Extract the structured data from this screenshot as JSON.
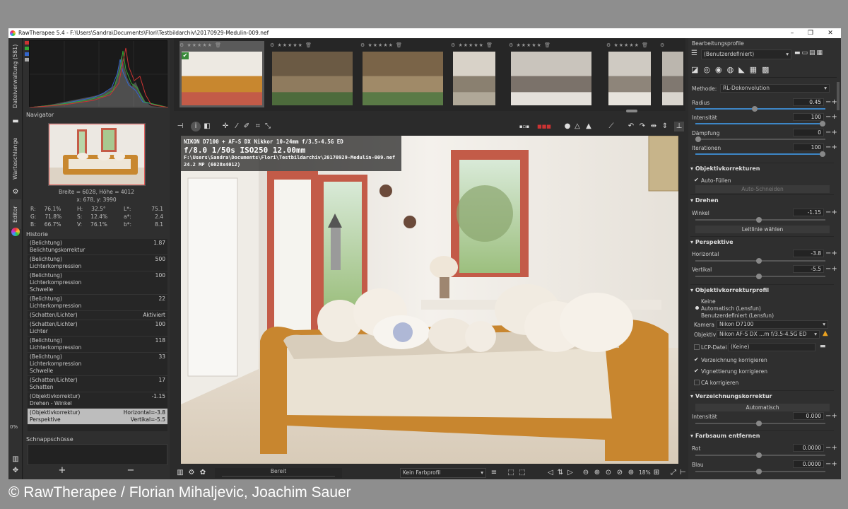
{
  "window": {
    "title": "RawTherapee 5.4 - F:\\Users\\Sandra\\Documents\\Flori\\Testbildarchiv\\20170929-Medulin-009.nef",
    "minimize": "–",
    "maximize": "❐",
    "close": "✕"
  },
  "sidetabs": {
    "file_browser": "Dateiverwaltung (581)",
    "queue": "Warteschlange",
    "editor": "Editor"
  },
  "navigator": {
    "title": "Navigator",
    "size": "Breite = 6028, Höhe = 4012",
    "coords": "x: 678, y: 3990",
    "rgb": [
      {
        "k": "R:",
        "v": "76.1%"
      },
      {
        "k": "G:",
        "v": "71.8%"
      },
      {
        "k": "B:",
        "v": "66.7%"
      }
    ],
    "hsv": [
      {
        "k": "H:",
        "v": "32.5°"
      },
      {
        "k": "S:",
        "v": "12.4%"
      },
      {
        "k": "V:",
        "v": "76.1%"
      }
    ],
    "lab": [
      {
        "k": "L*:",
        "v": "75.1"
      },
      {
        "k": "a*:",
        "v": "2.4"
      },
      {
        "k": "b*:",
        "v": "8.1"
      }
    ]
  },
  "history": {
    "title": "Historie",
    "rows": [
      {
        "name": "(Belichtung)\nBelichtungskorrektur",
        "value": "1.87"
      },
      {
        "name": "(Belichtung)\nLichterkompression",
        "value": "500"
      },
      {
        "name": "(Belichtung)\nLichterkompression\nSchwelle",
        "value": "100"
      },
      {
        "name": "(Belichtung)\nLichterkompression",
        "value": "22"
      },
      {
        "name": "(Schatten/Lichter)",
        "value": "Aktiviert"
      },
      {
        "name": "(Schatten/Lichter)\nLichter",
        "value": "100"
      },
      {
        "name": "(Belichtung)\nLichterkompression",
        "value": "118"
      },
      {
        "name": "(Belichtung)\nLichterkompression\nSchwelle",
        "value": "33"
      },
      {
        "name": "(Schatten/Lichter)\nSchatten",
        "value": "17"
      },
      {
        "name": "(Objektivkorrektur)\nDrehen - Winkel",
        "value": "-1.15"
      },
      {
        "name": "(Objektivkorrektur)\nPerspektive",
        "value": "Horizontal=-3.8\nVertikal=-5.5"
      }
    ]
  },
  "snapshots": {
    "title": "Schnappschüsse",
    "add": "+",
    "remove": "−",
    "zoom_pct": "0%"
  },
  "exif": {
    "line1": "NIKON D7100 + AF-S DX Nikkor 10-24mm f/3.5-4.5G ED",
    "line2": "f/8.0  1/50s  ISO250  12.00mm",
    "line3": "F:\\Users\\Sandra\\Documents\\Flori\\Testbildarchiv\\20170929-Medulin-009.nef",
    "line4": "24.2 MP (6028x4012)"
  },
  "statusbar": {
    "status": "Bereit",
    "profile": "Kein Farbprofil",
    "zoom": "18%"
  },
  "right": {
    "profiles_title": "Bearbeitungsprofile",
    "profile_value": "(Benutzerdefiniert)",
    "methode_label": "Methode:",
    "methode_value": "RL-Dekonvolution",
    "radius_label": "Radius",
    "radius": "0.45",
    "intensitaet_label": "Intensität",
    "intensitaet": "100",
    "daempfung_label": "Dämpfung",
    "daempfung": "0",
    "iterationen_label": "Iterationen",
    "iterationen": "100",
    "objektiv_head": "Objektivkorrekturen",
    "autofill": "Auto-Füllen",
    "autocrop": "Auto-Schneiden",
    "drehen_head": "Drehen",
    "winkel_label": "Winkel",
    "winkel": "-1.15",
    "leitlinie": "Leitlinie wählen",
    "perspektive_head": "Perspektive",
    "horizontal_label": "Horizontal",
    "horizontal": "-3.8",
    "vertikal_label": "Vertikal",
    "vertikal": "-5.5",
    "lensprofile_head": "Objektivkorrekturprofil",
    "opt_keine": "Keine",
    "opt_auto": "Automatisch (Lensfun)",
    "opt_user": "Benutzerdefiniert (Lensfun)",
    "kamera_label": "Kamera",
    "kamera": "Nikon D7100",
    "objektiv_label": "Objektiv",
    "objektiv": "Nikon AF-S DX ...m f/3.5-4.5G ED",
    "lcp_label": "LCP-Datei",
    "lcp": "(Keine)",
    "verzeichnung_ck": "Verzeichnung korrigieren",
    "vignette_ck": "Vignettierung korrigieren",
    "ca_ck": "CA korrigieren",
    "verz_head": "Verzeichnungskorrektur",
    "automatisch": "Automatisch",
    "verz_int_label": "Intensität",
    "verz_int": "0.000",
    "farbsaum_head": "Farbsaum entfernen",
    "rot_label": "Rot",
    "rot": "0.0000",
    "blau_label": "Blau",
    "blau": "0.0000"
  },
  "credit": "© RawTherapee / Florian Mihaljevic, Joachim Sauer",
  "colors": {
    "accent": "#3d86c6",
    "panel": "#2f2f2f",
    "dark": "#262626"
  }
}
